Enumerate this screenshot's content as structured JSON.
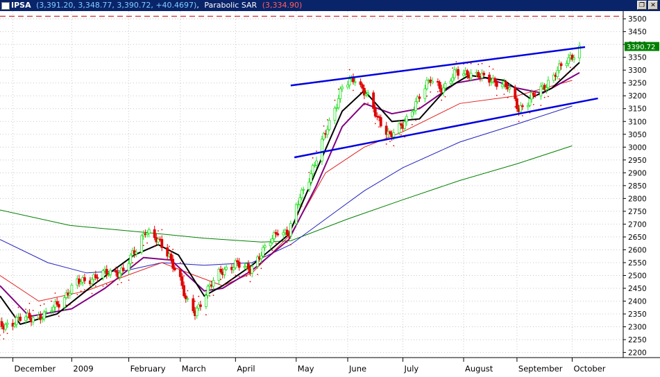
{
  "header": {
    "symbol": "IPSA",
    "values": "(3,391.20, 3,348.77, 3,390.72, +40.4697)",
    "indicator": "Parabolic SAR",
    "sar_value": "(3,334.90)"
  },
  "window_buttons": {
    "restore": "❐",
    "close": "✕"
  },
  "colors": {
    "up": "#22e022",
    "down": "#e00000",
    "sma_black": "#000000",
    "sma_purple": "#800080",
    "ma_red": "#e02020",
    "ma_blue": "#2020c0",
    "ma_green": "#008000",
    "sar": "#e00000",
    "trend": "#0000e0",
    "grid": "#c8c8c8",
    "last_price_bg": "#008000"
  },
  "chart_data": {
    "type": "candlestick",
    "price_label": "3390.72",
    "y_axis": {
      "min": 2180,
      "max": 3530,
      "ticks": [
        2200,
        2250,
        2300,
        2350,
        2400,
        2450,
        2500,
        2550,
        2600,
        2650,
        2700,
        2750,
        2800,
        2850,
        2900,
        2950,
        3000,
        3050,
        3100,
        3150,
        3200,
        3250,
        3300,
        3350,
        3400,
        3450,
        3500
      ]
    },
    "x_labels": [
      "December",
      "2009",
      "February",
      "March",
      "April",
      "May",
      "June",
      "July",
      "August",
      "September",
      "October"
    ],
    "x_label_dates": [
      "2008-12-01",
      "2009-01-02",
      "2009-02-02",
      "2009-03-02",
      "2009-04-01",
      "2009-05-04",
      "2009-06-01",
      "2009-07-01",
      "2009-08-03",
      "2009-09-01",
      "2009-10-01"
    ],
    "x_range": [
      "2008-11-24",
      "2009-10-08"
    ],
    "close_path": [
      [
        "2008-11-24",
        2300
      ],
      [
        "2008-12-05",
        2330
      ],
      [
        "2008-12-19",
        2345
      ],
      [
        "2009-01-05",
        2470
      ],
      [
        "2009-01-16",
        2500
      ],
      [
        "2009-01-30",
        2520
      ],
      [
        "2009-02-06",
        2600
      ],
      [
        "2009-02-11",
        2680
      ],
      [
        "2009-02-18",
        2630
      ],
      [
        "2009-02-24",
        2580
      ],
      [
        "2009-03-02",
        2480
      ],
      [
        "2009-03-05",
        2400
      ],
      [
        "2009-03-10",
        2360
      ],
      [
        "2009-03-16",
        2430
      ],
      [
        "2009-03-24",
        2520
      ],
      [
        "2009-04-01",
        2540
      ],
      [
        "2009-04-09",
        2530
      ],
      [
        "2009-04-17",
        2600
      ],
      [
        "2009-04-24",
        2680
      ],
      [
        "2009-04-30",
        2660
      ],
      [
        "2009-05-06",
        2810
      ],
      [
        "2009-05-14",
        2930
      ],
      [
        "2009-05-21",
        3080
      ],
      [
        "2009-05-29",
        3230
      ],
      [
        "2009-06-05",
        3270
      ],
      [
        "2009-06-11",
        3210
      ],
      [
        "2009-06-17",
        3110
      ],
      [
        "2009-06-24",
        3050
      ],
      [
        "2009-07-01",
        3080
      ],
      [
        "2009-07-09",
        3190
      ],
      [
        "2009-07-16",
        3260
      ],
      [
        "2009-07-23",
        3230
      ],
      [
        "2009-07-30",
        3290
      ],
      [
        "2009-08-06",
        3290
      ],
      [
        "2009-08-13",
        3270
      ],
      [
        "2009-08-20",
        3260
      ],
      [
        "2009-08-27",
        3230
      ],
      [
        "2009-09-02",
        3150
      ],
      [
        "2009-09-07",
        3180
      ],
      [
        "2009-09-15",
        3230
      ],
      [
        "2009-09-22",
        3290
      ],
      [
        "2009-09-29",
        3340
      ],
      [
        "2009-10-05",
        3390
      ]
    ],
    "series": [
      {
        "key": "ma_green",
        "points": [
          [
            "2008-11-24",
            2755
          ],
          [
            "2009-01-01",
            2695
          ],
          [
            "2009-02-15",
            2665
          ],
          [
            "2009-03-15",
            2645
          ],
          [
            "2009-04-15",
            2630
          ],
          [
            "2009-05-01",
            2635
          ],
          [
            "2009-06-01",
            2720
          ],
          [
            "2009-07-01",
            2795
          ],
          [
            "2009-08-01",
            2870
          ],
          [
            "2009-09-01",
            2935
          ],
          [
            "2009-10-01",
            3005
          ]
        ]
      },
      {
        "key": "ma_blue",
        "points": [
          [
            "2008-11-24",
            2640
          ],
          [
            "2008-12-20",
            2550
          ],
          [
            "2009-01-10",
            2510
          ],
          [
            "2009-02-01",
            2520
          ],
          [
            "2009-02-20",
            2550
          ],
          [
            "2009-03-15",
            2540
          ],
          [
            "2009-04-10",
            2550
          ],
          [
            "2009-05-01",
            2620
          ],
          [
            "2009-05-20",
            2720
          ],
          [
            "2009-06-10",
            2830
          ],
          [
            "2009-07-01",
            2920
          ],
          [
            "2009-08-01",
            3020
          ],
          [
            "2009-09-01",
            3090
          ],
          [
            "2009-10-01",
            3160
          ]
        ]
      },
      {
        "key": "ma_red",
        "points": [
          [
            "2008-11-24",
            2500
          ],
          [
            "2008-12-15",
            2400
          ],
          [
            "2009-01-10",
            2440
          ],
          [
            "2009-02-01",
            2500
          ],
          [
            "2009-02-20",
            2550
          ],
          [
            "2009-03-10",
            2500
          ],
          [
            "2009-03-25",
            2460
          ],
          [
            "2009-04-10",
            2510
          ],
          [
            "2009-05-01",
            2660
          ],
          [
            "2009-05-20",
            2900
          ],
          [
            "2009-06-10",
            3000
          ],
          [
            "2009-07-01",
            3060
          ],
          [
            "2009-08-01",
            3170
          ],
          [
            "2009-09-01",
            3200
          ],
          [
            "2009-10-01",
            3260
          ]
        ]
      },
      {
        "key": "sma_purple",
        "points": [
          [
            "2008-11-24",
            2460
          ],
          [
            "2008-12-10",
            2340
          ],
          [
            "2009-01-02",
            2370
          ],
          [
            "2009-01-20",
            2450
          ],
          [
            "2009-02-10",
            2570
          ],
          [
            "2009-02-25",
            2560
          ],
          [
            "2009-03-15",
            2440
          ],
          [
            "2009-03-25",
            2450
          ],
          [
            "2009-04-10",
            2520
          ],
          [
            "2009-04-30",
            2640
          ],
          [
            "2009-05-15",
            2850
          ],
          [
            "2009-05-29",
            3080
          ],
          [
            "2009-06-10",
            3170
          ],
          [
            "2009-06-25",
            3130
          ],
          [
            "2009-07-10",
            3150
          ],
          [
            "2009-07-30",
            3250
          ],
          [
            "2009-08-15",
            3270
          ],
          [
            "2009-09-01",
            3230
          ],
          [
            "2009-09-15",
            3210
          ],
          [
            "2009-10-05",
            3290
          ]
        ]
      },
      {
        "key": "sma_black",
        "points": [
          [
            "2008-11-24",
            2420
          ],
          [
            "2008-12-05",
            2310
          ],
          [
            "2008-12-25",
            2350
          ],
          [
            "2009-01-15",
            2470
          ],
          [
            "2009-02-05",
            2580
          ],
          [
            "2009-02-18",
            2620
          ],
          [
            "2009-03-01",
            2580
          ],
          [
            "2009-03-15",
            2420
          ],
          [
            "2009-03-25",
            2460
          ],
          [
            "2009-04-10",
            2540
          ],
          [
            "2009-04-30",
            2660
          ],
          [
            "2009-05-15",
            2910
          ],
          [
            "2009-05-29",
            3140
          ],
          [
            "2009-06-10",
            3220
          ],
          [
            "2009-06-25",
            3100
          ],
          [
            "2009-07-10",
            3110
          ],
          [
            "2009-07-25",
            3230
          ],
          [
            "2009-08-06",
            3280
          ],
          [
            "2009-08-25",
            3260
          ],
          [
            "2009-09-08",
            3190
          ],
          [
            "2009-09-20",
            3230
          ],
          [
            "2009-10-05",
            3330
          ]
        ]
      }
    ],
    "trendlines": [
      {
        "from": [
          "2009-05-01",
          3240
        ],
        "to": [
          "2009-10-08",
          3390
        ]
      },
      {
        "from": [
          "2009-05-03",
          2960
        ],
        "to": [
          "2009-10-15",
          3190
        ]
      }
    ],
    "resistance": 3510
  }
}
